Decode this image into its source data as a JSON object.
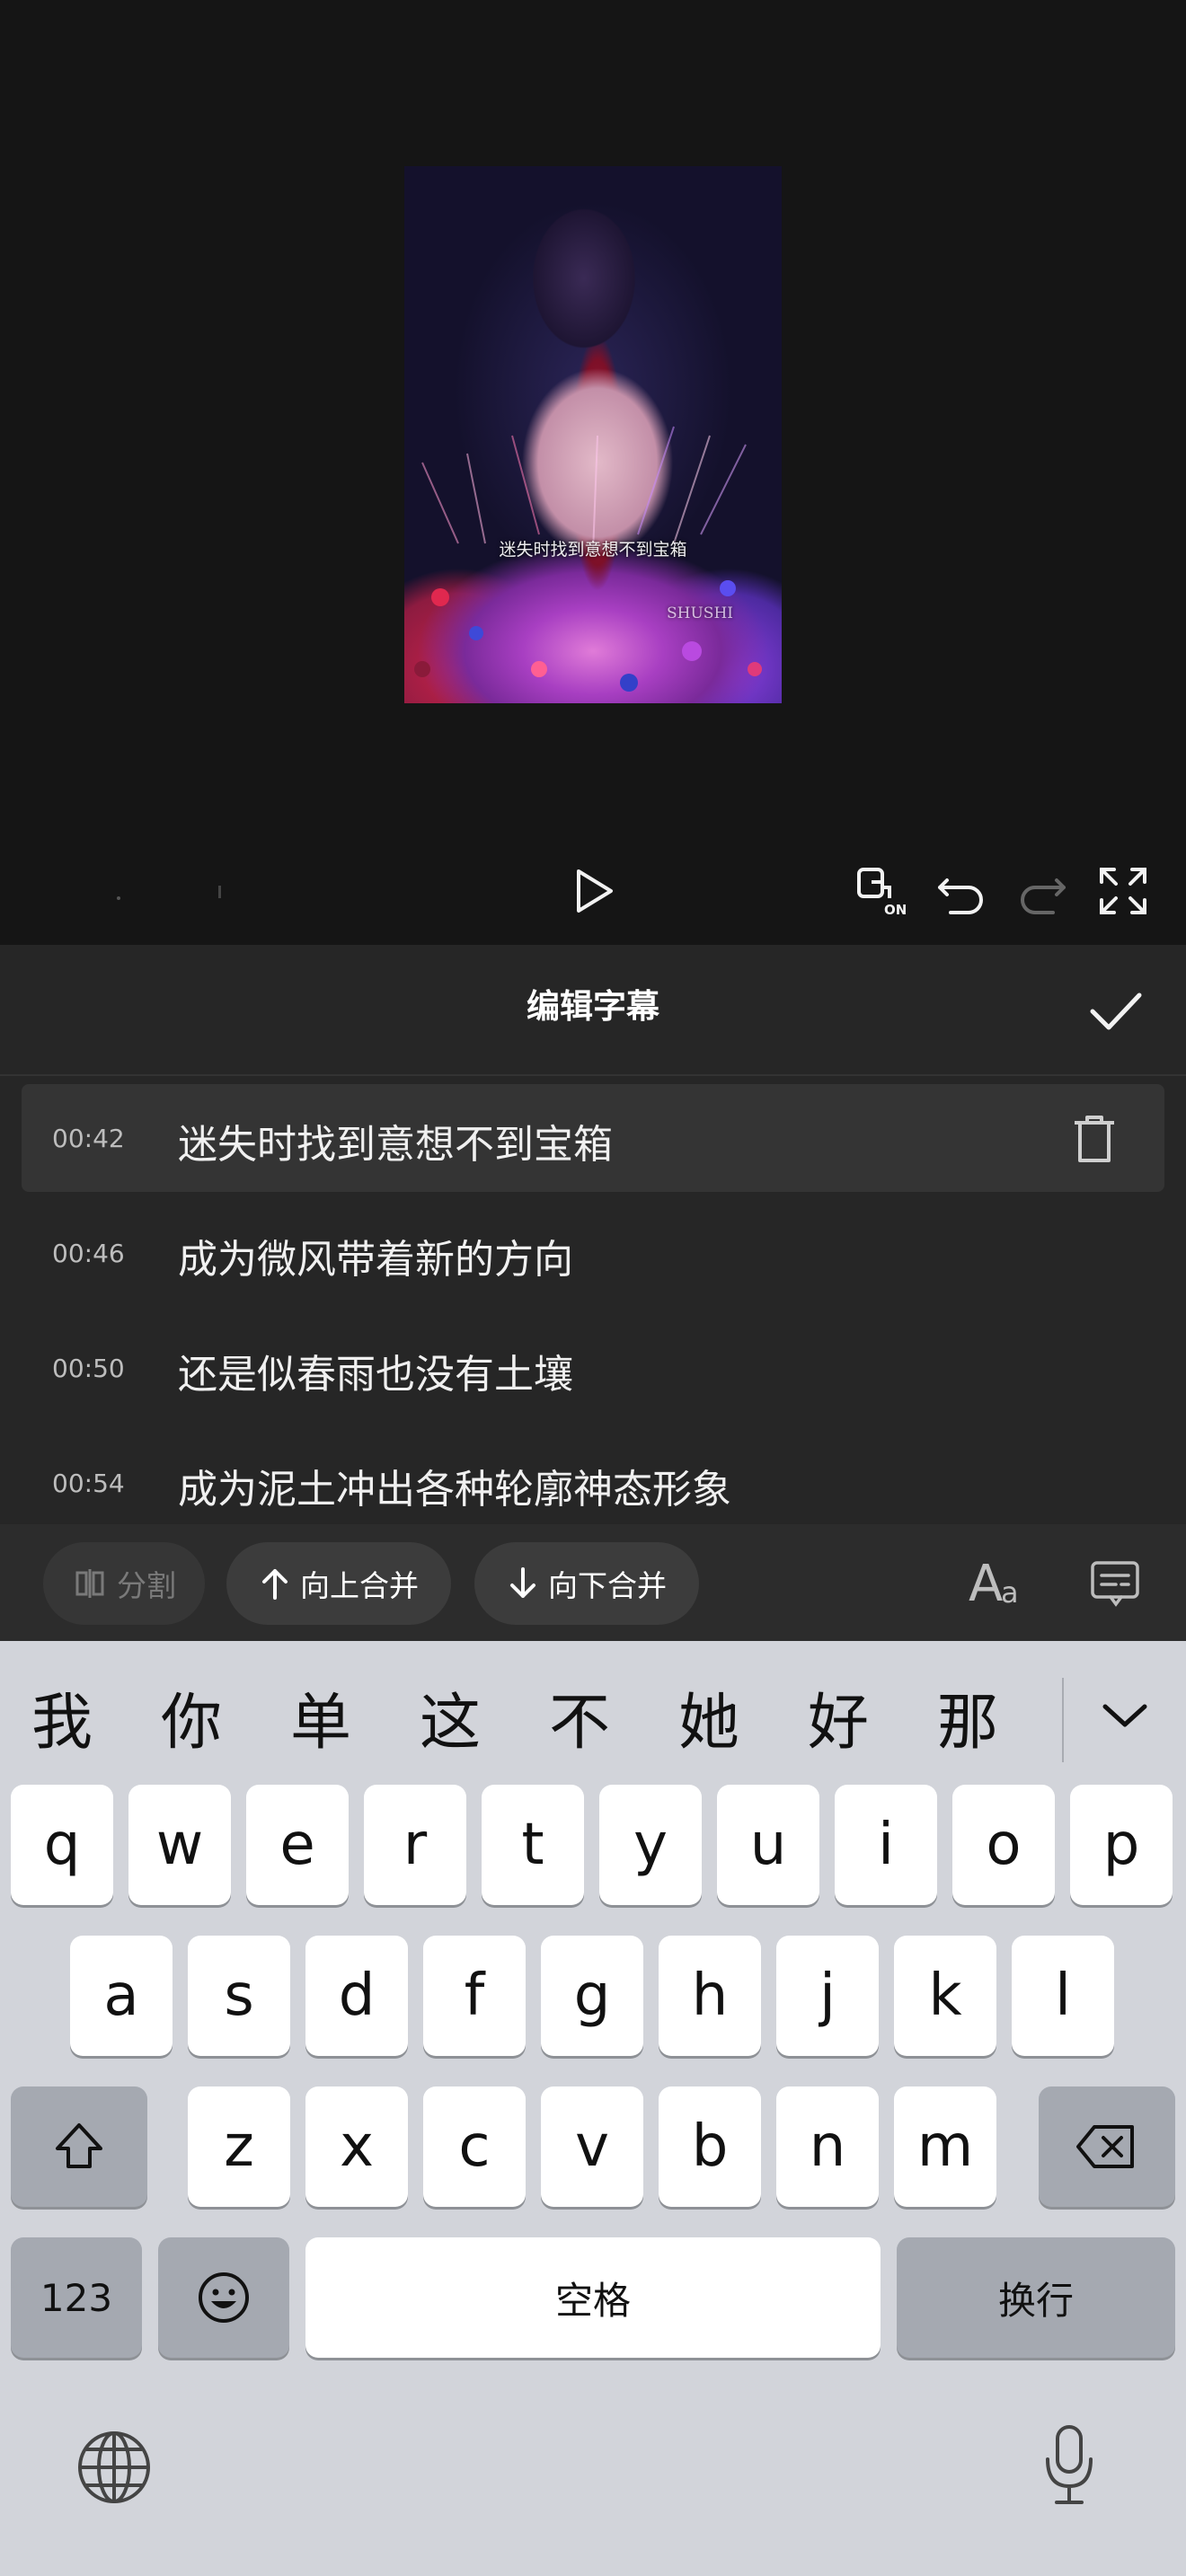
{
  "video": {
    "caption": "迷失时找到意想不到宝箱",
    "watermark": "SHUSHI"
  },
  "controls": {
    "play_icon": "play-icon",
    "compare_icon": "compare-on-icon",
    "undo_icon": "undo-icon",
    "redo_icon": "redo-icon",
    "fullscreen_icon": "fullscreen-icon"
  },
  "panel": {
    "title": "编辑字幕",
    "confirm_icon": "checkmark-icon",
    "rows": [
      {
        "time": "00:42",
        "text": "迷失时找到意想不到宝箱",
        "selected": true
      },
      {
        "time": "00:46",
        "text": "成为微风带着新的方向"
      },
      {
        "time": "00:50",
        "text": "还是似春雨也没有土壤"
      },
      {
        "time": "00:54",
        "text": "成为泥土冲出各种轮廓神态形象"
      }
    ],
    "actions": {
      "split": "分割",
      "merge_up": "向上合并",
      "merge_down": "向下合并"
    }
  },
  "keyboard": {
    "candidates": [
      "我",
      "你",
      "单",
      "这",
      "不",
      "她",
      "好",
      "那"
    ],
    "row1": [
      "q",
      "w",
      "e",
      "r",
      "t",
      "y",
      "u",
      "i",
      "o",
      "p"
    ],
    "row2": [
      "a",
      "s",
      "d",
      "f",
      "g",
      "h",
      "j",
      "k",
      "l"
    ],
    "row3": [
      "z",
      "x",
      "c",
      "v",
      "b",
      "n",
      "m"
    ],
    "numbers_key": "123",
    "space_key": "空格",
    "return_key": "换行"
  }
}
